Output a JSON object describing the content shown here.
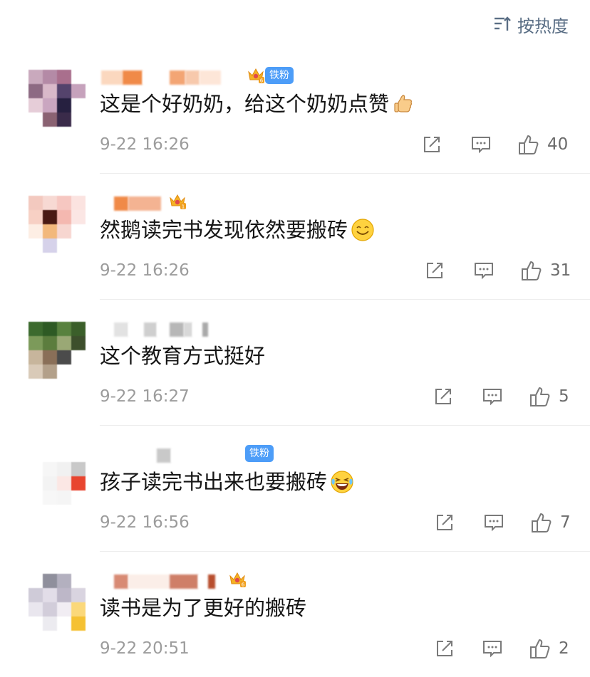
{
  "header": {
    "sort_label": "按热度",
    "sort_icon": "sort-descending-icon"
  },
  "comments": [
    {
      "text": "这是个好奶奶，给这个奶奶点赞",
      "emoji": "thumbs-up-emoji",
      "time": "9-22 16:26",
      "likes": "40",
      "badge": "铁粉",
      "crown_level": "6"
    },
    {
      "text": "然鹅读完书发现依然要搬砖",
      "emoji": "smile-emoji",
      "time": "9-22 16:26",
      "likes": "31",
      "badge": "",
      "crown_level": "1"
    },
    {
      "text": "这个教育方式挺好",
      "emoji": "",
      "time": "9-22 16:27",
      "likes": "5",
      "badge": "",
      "crown_level": ""
    },
    {
      "text": "孩子读完书出来也要搬砖",
      "emoji": "laughing-tears-emoji",
      "time": "9-22 16:56",
      "likes": "7",
      "badge": "铁粉",
      "crown_level": ""
    },
    {
      "text": "读书是为了更好的搬砖",
      "emoji": "",
      "time": "9-22 20:51",
      "likes": "2",
      "badge": "",
      "crown_level": "6"
    }
  ],
  "colors": {
    "accent_blue": "#4d9df8",
    "sort_text": "#5a6e85",
    "time_text": "#9c9c9c",
    "crown_gold": "#f5b224"
  }
}
